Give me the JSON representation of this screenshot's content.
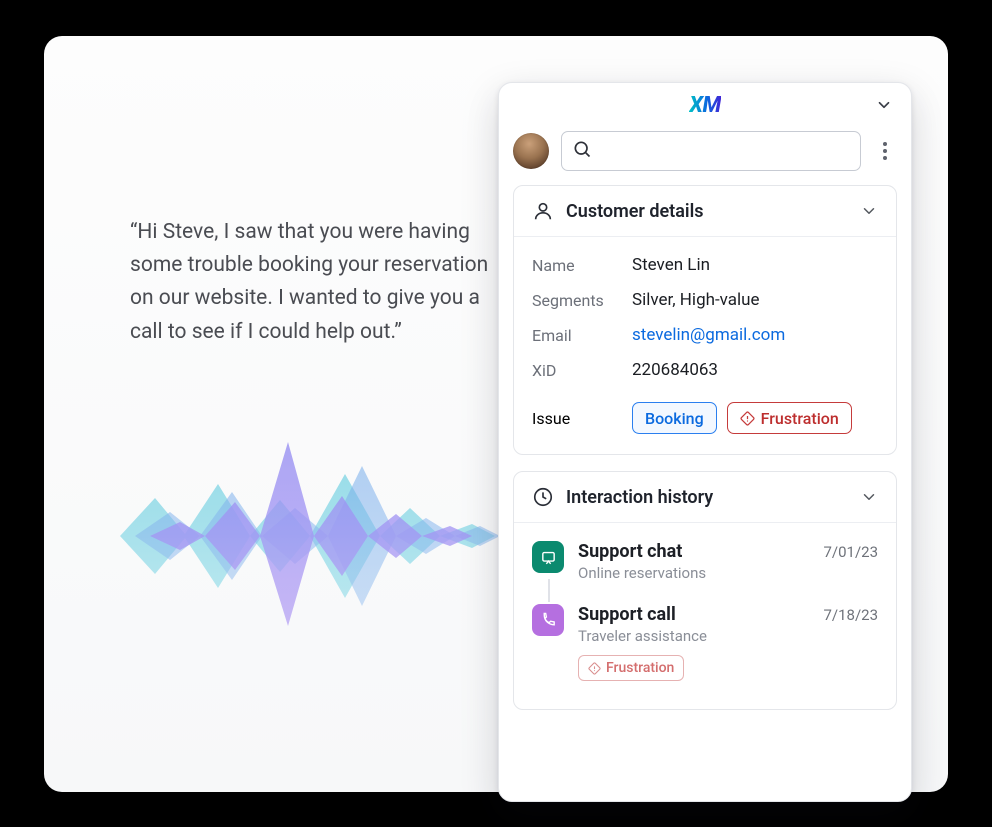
{
  "brand": "XM",
  "quote": "“Hi Steve, I saw that you were having some trouble booking your reservation on our website. I wanted to give you a call to see if I could help out.”",
  "search": {
    "value": "",
    "placeholder": ""
  },
  "customer_card": {
    "title": "Customer details",
    "fields": {
      "name_label": "Name",
      "name": "Steven Lin",
      "segments_label": "Segments",
      "segments": "Silver, High-value",
      "email_label": "Email",
      "email": "stevelin@gmail.com",
      "xid_label": "XiD",
      "xid": "220684063",
      "issue_label": "Issue"
    },
    "tags": {
      "booking": "Booking",
      "frustration": "Frustration"
    }
  },
  "history_card": {
    "title": "Interaction history",
    "items": [
      {
        "title": "Support chat",
        "subtitle": "Online reservations",
        "date": "7/01/23",
        "icon": "chat",
        "tags": []
      },
      {
        "title": "Support call",
        "subtitle": "Traveler assistance",
        "date": "7/18/23",
        "icon": "phone",
        "tags": [
          "Frustration"
        ]
      }
    ]
  }
}
